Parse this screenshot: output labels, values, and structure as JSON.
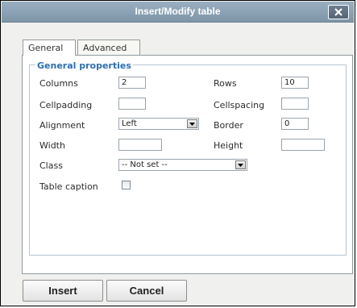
{
  "dialog": {
    "title": "Insert/Modify table"
  },
  "tabs": [
    {
      "label": "General",
      "active": true
    },
    {
      "label": "Advanced",
      "active": false
    }
  ],
  "general": {
    "legend": "General properties",
    "columns": {
      "label": "Columns",
      "value": "2"
    },
    "rows": {
      "label": "Rows",
      "value": "10"
    },
    "cellpadding": {
      "label": "Cellpadding",
      "value": ""
    },
    "cellspacing": {
      "label": "Cellspacing",
      "value": ""
    },
    "alignment": {
      "label": "Alignment",
      "value": "Left"
    },
    "border": {
      "label": "Border",
      "value": "0"
    },
    "width": {
      "label": "Width",
      "value": ""
    },
    "height": {
      "label": "Height",
      "value": ""
    },
    "class": {
      "label": "Class",
      "value": "-- Not set --"
    },
    "caption": {
      "label": "Table caption",
      "checked": false
    }
  },
  "buttons": {
    "insert": "Insert",
    "cancel": "Cancel"
  },
  "icons": {
    "close": "close-icon",
    "dropdown": "chevron-down-icon"
  },
  "colors": {
    "titlebar": "#8aa1b4",
    "legend": "#2b6fb6"
  }
}
